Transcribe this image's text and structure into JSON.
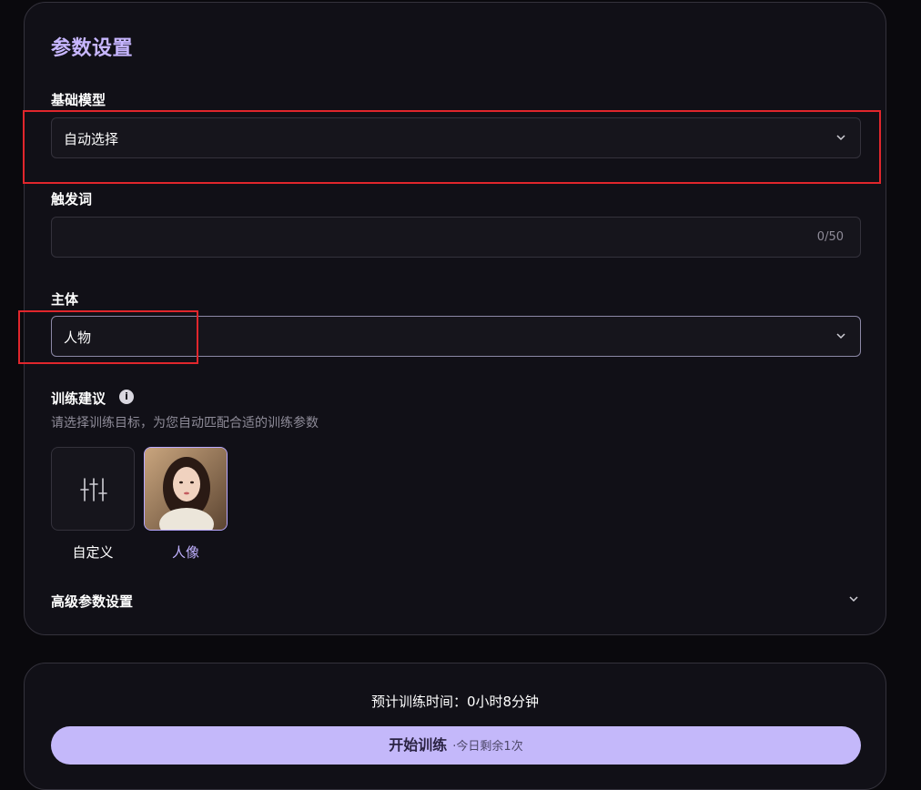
{
  "panel": {
    "title": "参数设置",
    "base_model": {
      "label": "基础模型",
      "value": "自动选择"
    },
    "trigger_word": {
      "label": "触发词",
      "value": "",
      "counter": "0/50"
    },
    "subject": {
      "label": "主体",
      "value": "人物"
    },
    "suggestion": {
      "label": "训练建议",
      "hint": "请选择训练目标，为您自动匹配合适的训练参数",
      "presets": [
        {
          "label": "自定义",
          "icon": "sliders-icon",
          "selected": false
        },
        {
          "label": "人像",
          "icon": "portrait-thumbnail",
          "selected": true
        }
      ]
    },
    "advanced": {
      "label": "高级参数设置"
    }
  },
  "footer": {
    "eta": "预计训练时间：0小时8分钟",
    "start_label": "开始训练",
    "remaining": "·今日剩余1次"
  },
  "colors": {
    "accent": "#c4b8fa",
    "title": "#c7b6ff",
    "highlight": "#e0262c",
    "background": "#0a090d",
    "panel": "#111017"
  }
}
